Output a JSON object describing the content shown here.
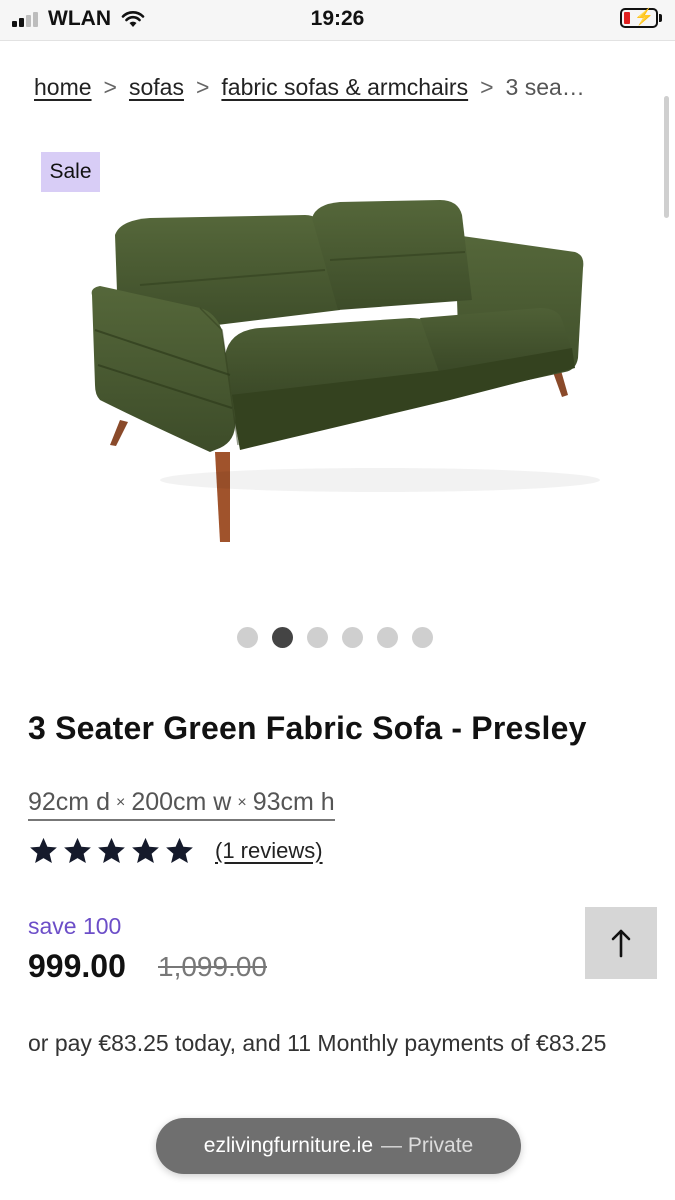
{
  "status_bar": {
    "carrier": "WLAN",
    "time": "19:26"
  },
  "breadcrumb": {
    "items": [
      "home",
      "sofas",
      "fabric sofas & armchairs"
    ],
    "separator": ">",
    "current": "3 sea…"
  },
  "gallery": {
    "badge": "Sale",
    "image_alt": "green fabric sofa",
    "slide_count": 6,
    "active_slide": 2
  },
  "product": {
    "title": "3 Seater Green Fabric Sofa - Presley",
    "dimensions": {
      "depth": "92cm d",
      "width": "200cm w",
      "height": "93cm h",
      "separator": "×"
    },
    "rating": 5,
    "rating_max": 5,
    "reviews_label": "(1 reviews)"
  },
  "pricing": {
    "save": "save 100",
    "price": "999.00",
    "was_price": "1,099.00",
    "finance": "or pay €83.25 today, and 11 Monthly payments of €83.25"
  },
  "back_to_top_icon": "arrow-up-icon",
  "browser": {
    "domain": "ezlivingfurniture.ie",
    "mode": "— Private"
  },
  "colors": {
    "sale_badge": "#d8cdf6",
    "save_text": "#6c4ec8",
    "sofa_fabric": "#4a5a32",
    "battery_low": "#e02020"
  }
}
